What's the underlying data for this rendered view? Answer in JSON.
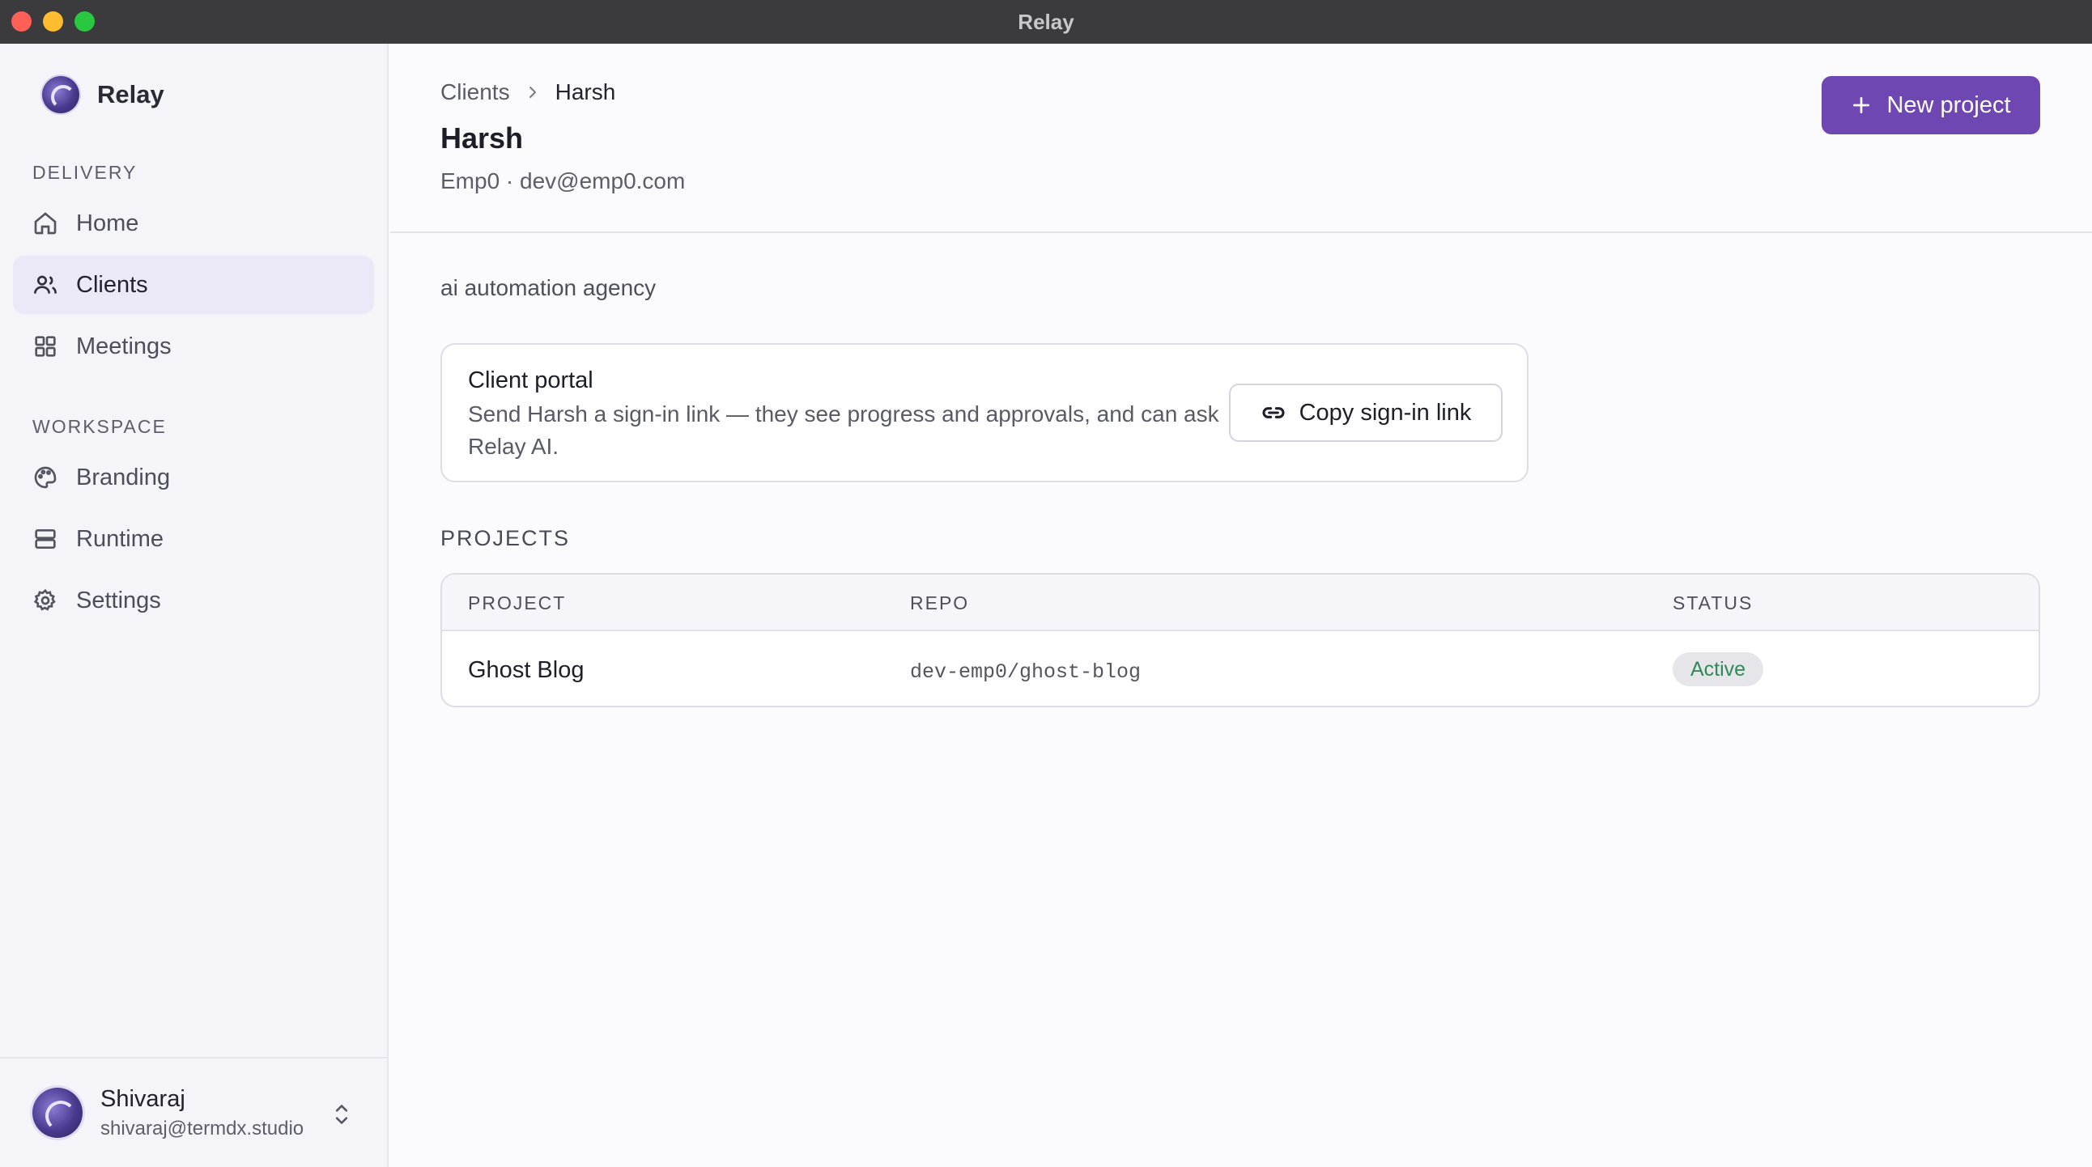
{
  "window": {
    "title": "Relay"
  },
  "sidebar": {
    "brand": "Relay",
    "sections": [
      {
        "label": "DELIVERY"
      },
      {
        "label": "WORKSPACE"
      }
    ],
    "items": [
      {
        "label": "Home",
        "icon": "home-icon"
      },
      {
        "label": "Clients",
        "icon": "users-icon",
        "active": true
      },
      {
        "label": "Meetings",
        "icon": "grid-icon"
      },
      {
        "label": "Branding",
        "icon": "palette-icon"
      },
      {
        "label": "Runtime",
        "icon": "server-icon"
      },
      {
        "label": "Settings",
        "icon": "gear-icon"
      }
    ],
    "user": {
      "name": "Shivaraj",
      "email": "shivaraj@termdx.studio"
    }
  },
  "header": {
    "breadcrumb": {
      "parent": "Clients",
      "current": "Harsh"
    },
    "title": "Harsh",
    "subtitle": "Emp0 · dev@emp0.com",
    "new_project_label": "New project"
  },
  "client": {
    "description": "ai automation agency",
    "portal": {
      "title": "Client portal",
      "text": "Send Harsh a sign-in link — they see progress and approvals, and can ask Relay AI.",
      "copy_button_label": "Copy sign-in link"
    }
  },
  "projects": {
    "section_label": "PROJECTS",
    "columns": [
      "PROJECT",
      "REPO",
      "STATUS"
    ],
    "rows": [
      {
        "project": "Ghost Blog",
        "repo": "dev-emp0/ghost-blog",
        "status": "Active"
      }
    ]
  },
  "colors": {
    "accent": "#6f47b3",
    "active_nav_bg": "#ebe8f8",
    "status_active": "#2f8a57"
  }
}
